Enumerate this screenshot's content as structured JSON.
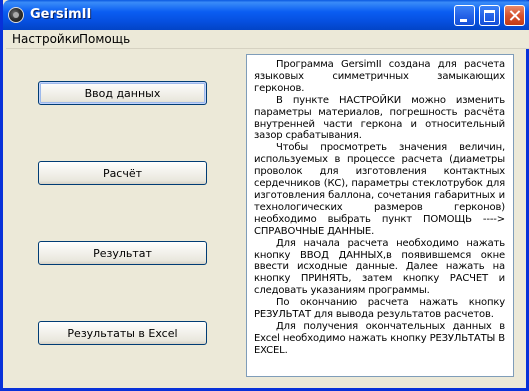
{
  "window": {
    "title": "GersimII"
  },
  "menu": {
    "items": [
      "Настройки",
      "Помощь"
    ]
  },
  "buttons": {
    "input": "Ввод данных",
    "calc": "Расчёт",
    "result": "Результат",
    "excel": "Результаты в Excel"
  },
  "info": {
    "paragraphs": [
      "Программа GersimII создана для расчета языковых симметричных замыкающих герконов.",
      "В пункте НАСТРОЙКИ можно изменить параметры материалов, погрешность расчёта внутренней части геркона и относительный зазор срабатывания.",
      "Чтобы просмотреть значения величин, используемых в процессе расчета (диаметры проволок для изготовления контактных сердечников (КС), параметры стеклотрубок для изготовления баллона, сочетания габаритных и технологических размеров герконов) необходимо выбрать пункт ПОМОЩЬ ----> СПРАВОЧНЫЕ ДАННЫЕ.",
      "Для начала расчета необходимо нажать кнопку ВВОД ДАННЫХ,в появившемся окне ввести исходные данные. Далее нажать на кнопку ПРИНЯТЬ, затем кнопку РАСЧЕТ и следовать указаниям программы.",
      "По окончанию расчета нажать кнопку РЕЗУЛЬТАТ для вывода результатов расчетов.",
      "Для получения окончательных данных в Excel необходимо нажать кнопку РЕЗУЛЬТАТЫ В EXCEL."
    ]
  }
}
